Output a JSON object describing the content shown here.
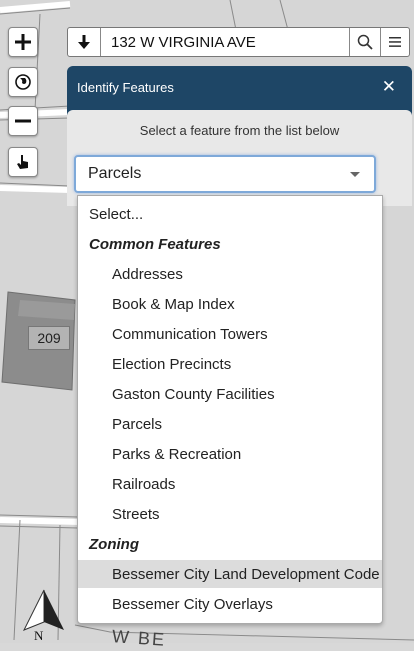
{
  "search": {
    "address": "132 W VIRGINIA AVE"
  },
  "map": {
    "parcel_label": "209",
    "street_label": "W BE",
    "north_label": "N"
  },
  "panel": {
    "title": "Identify Features",
    "close_glyph": "✕",
    "instructions": "Select a feature from the list below",
    "selected": "Parcels"
  },
  "dropdown": {
    "placeholder": "Select...",
    "groups": [
      {
        "label": "Common Features",
        "items": [
          "Addresses",
          "Book & Map Index",
          "Communication Towers",
          "Election Precincts",
          "Gaston County Facilities",
          "Parcels",
          "Parks & Recreation",
          "Railroads",
          "Streets"
        ]
      },
      {
        "label": "Zoning",
        "items": [
          "Bessemer City Land Development Code",
          "Bessemer City Overlays"
        ]
      }
    ],
    "highlighted": "Bessemer City Land Development Code"
  },
  "icons": {
    "zoom_in": "plus-icon",
    "basemap": "globe-icon",
    "zoom_out": "minus-icon",
    "identify": "pointer-hand-icon",
    "search_mode": "arrow-down-icon",
    "search": "magnifier-icon",
    "menu": "hamburger-menu-icon",
    "compass": "north-arrow-icon"
  },
  "colors": {
    "panel_header": "#1e4666",
    "panel_body": "#e8e8e8",
    "select_focus": "#7ea9d9",
    "highlight": "#dcdcdc"
  }
}
